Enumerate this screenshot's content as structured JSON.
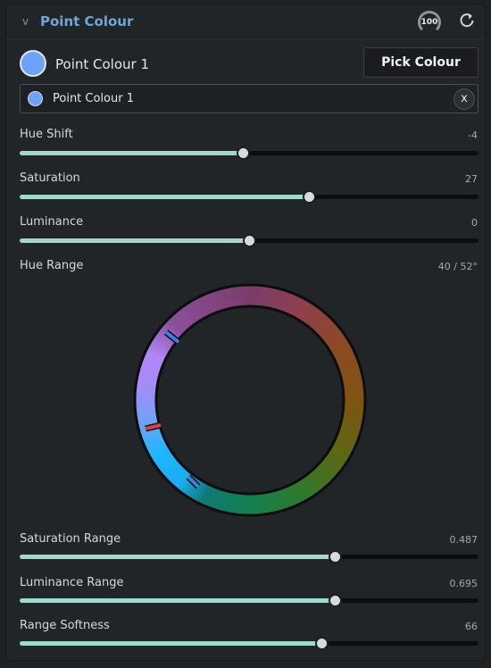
{
  "header": {
    "collapse_glyph": "v",
    "title": "Point Colour",
    "badge": "100",
    "reset_icon": "reset-icon"
  },
  "colour": {
    "swatch_color": "#6ea2f8",
    "label": "Point Colour 1",
    "pick_button": "Pick Colour"
  },
  "chip": {
    "label": "Point Colour 1",
    "remove": "x"
  },
  "sliders": [
    {
      "label": "Hue Shift",
      "value": "-4",
      "fraction": 0.487
    },
    {
      "label": "Saturation",
      "value": "27",
      "fraction": 0.631
    },
    {
      "label": "Luminance",
      "value": "0",
      "fraction": 0.5
    }
  ],
  "hue_range": {
    "label": "Hue Range",
    "value": "40 / 52°"
  },
  "range_sliders": [
    {
      "label": "Saturation Range",
      "value": "0.487",
      "fraction": 0.687
    },
    {
      "label": "Luminance Range",
      "value": "0.695",
      "fraction": 0.687
    },
    {
      "label": "Range Softness",
      "value": "66",
      "fraction": 0.658
    }
  ],
  "colors": {
    "accent_fill": "#9fd8cc",
    "title": "#6fa6d6"
  }
}
